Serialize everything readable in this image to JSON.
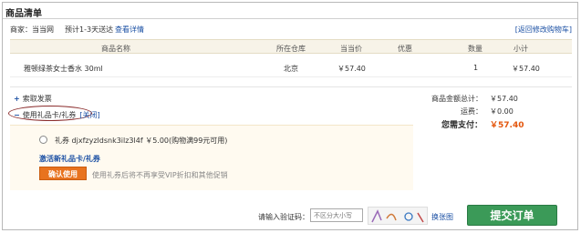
{
  "page": {
    "title": "商品清单"
  },
  "info": {
    "merchant": "商家：当当网",
    "eta": "预计1-3天送达",
    "details_link": "查看详情",
    "back_link": "[返回修改购物车]"
  },
  "table": {
    "headers": [
      "商品名称",
      "所在仓库",
      "当当价",
      "优惠",
      "数量",
      "小计"
    ],
    "rows": [
      {
        "name": "雅顿绿茶女士香水 30ml",
        "warehouse": "北京",
        "price": "￥57.40",
        "discount": "",
        "qty": "1",
        "subtotal": "￥57.40"
      }
    ]
  },
  "options": {
    "invoice": "索取发票",
    "use_gift": "使用礼品卡/礼券",
    "close_link": "[关闭]"
  },
  "summary": {
    "total_label": "商品金额总计：",
    "total_value": "￥57.40",
    "shipping_label": "运费：",
    "shipping_value": "￥0.00",
    "pay_label": "您需支付：",
    "pay_value": "￥57.40"
  },
  "gift": {
    "line": "礼券 djxfzyzldsnk3ilz3l4f ￥5.00(购物满99元可用)",
    "activate": "激活新礼品卡/礼券",
    "use_button": "确认使用",
    "use_hint": "使用礼券后将不再享受VIP折扣和其他促销"
  },
  "captcha": {
    "label": "请输入验证码：",
    "placeholder": "不区分大小写",
    "refresh": "换张图"
  },
  "submit": {
    "label": "提交订单"
  },
  "colors": {
    "accent": "#e8731f",
    "submit": "#3b9a58",
    "link": "#1a4fa3",
    "price": "#e4570e"
  }
}
